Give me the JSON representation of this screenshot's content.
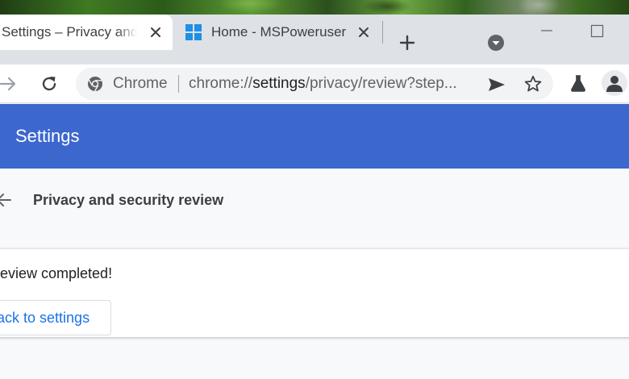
{
  "tabs": [
    {
      "title": "Settings – Privacy and security",
      "active": true
    },
    {
      "title": "Home - MSPoweruser",
      "active": false
    }
  ],
  "tab_strip": {
    "new_tab_icon": "plus-icon",
    "tab_search_icon": "chevron-down-circle-icon",
    "window_controls": [
      "minimize-icon",
      "maximize-icon"
    ]
  },
  "toolbar": {
    "nav_icons": [
      "forward-icon",
      "reload-icon"
    ],
    "site_chip": "Chrome",
    "url_scheme": "chrome://",
    "url_host": "settings",
    "url_path": "/privacy/review?step...",
    "action_icons": [
      "send-icon",
      "star-icon",
      "labs-icon",
      "avatar-icon"
    ]
  },
  "header": {
    "title": "Settings"
  },
  "page": {
    "heading": "Privacy and security review",
    "completion_message": "Review completed!",
    "back_button_label": "Back to settings"
  },
  "colors": {
    "header_bg": "#3c67cd",
    "link_blue": "#1a73e8",
    "windows_logo": "#1e90e6"
  }
}
